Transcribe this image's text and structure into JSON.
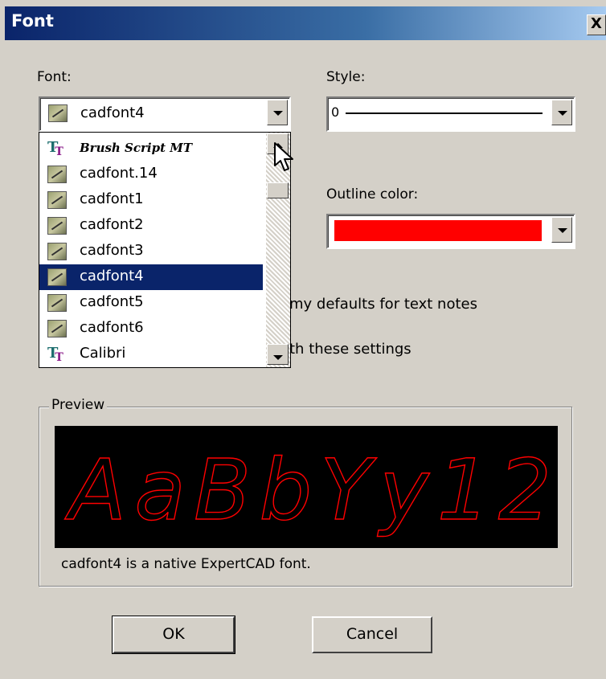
{
  "window": {
    "title": "Font",
    "close_label": "X"
  },
  "font": {
    "label": "Font:",
    "selected": "cadfont4",
    "options": [
      {
        "name": "Brush Script MT",
        "icon": "truetype-icon",
        "selected": false
      },
      {
        "name": "cadfont.14",
        "icon": "cad-font-icon",
        "selected": false
      },
      {
        "name": "cadfont1",
        "icon": "cad-font-icon",
        "selected": false
      },
      {
        "name": "cadfont2",
        "icon": "cad-font-icon",
        "selected": false
      },
      {
        "name": "cadfont3",
        "icon": "cad-font-icon",
        "selected": false
      },
      {
        "name": "cadfont4",
        "icon": "cad-font-icon",
        "selected": true
      },
      {
        "name": "cadfont5",
        "icon": "cad-font-icon",
        "selected": false
      },
      {
        "name": "cadfont6",
        "icon": "cad-font-icon",
        "selected": false
      },
      {
        "name": "Calibri",
        "icon": "truetype-icon",
        "selected": false
      }
    ]
  },
  "style": {
    "label": "Style:",
    "value": "0"
  },
  "outline": {
    "label": "Outline color:",
    "color": "#ff0000"
  },
  "checkbox_fragments": {
    "defaults": "my defaults for text notes",
    "settings": "th these settings"
  },
  "preview": {
    "legend": "Preview",
    "sample_text": "AaBbYy12",
    "text_color": "#ff0000",
    "note": "cadfont4 is a native ExpertCAD font."
  },
  "buttons": {
    "ok": "OK",
    "cancel": "Cancel"
  }
}
